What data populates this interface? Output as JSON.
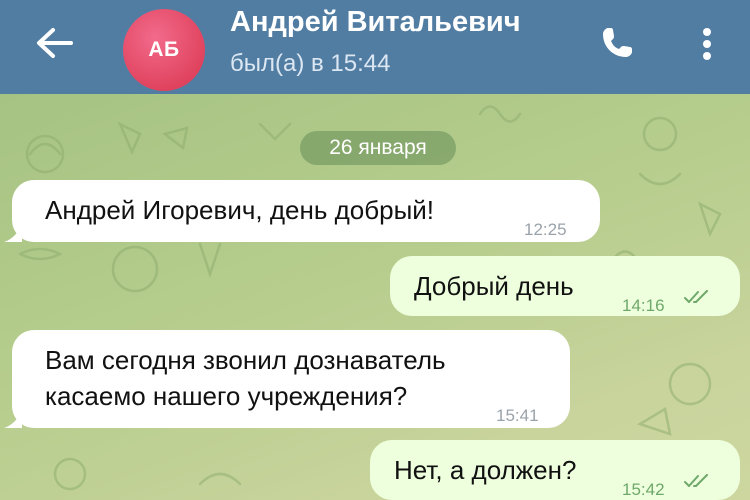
{
  "header": {
    "back_icon": "arrow-left-icon",
    "avatar_initials": "АБ",
    "contact_name": "Андрей Витальевич",
    "status": "был(а) в 15:44",
    "call_icon": "phone-icon",
    "menu_icon": "vertical-dots-icon",
    "color": "#527da3"
  },
  "chat": {
    "date": "26 января",
    "messages": [
      {
        "direction": "incoming",
        "text": "Андрей Игоревич, день добрый!",
        "time": "12:25"
      },
      {
        "direction": "outgoing",
        "text": "Добрый день",
        "time": "14:16",
        "status_icon": "double-check-icon"
      },
      {
        "direction": "incoming",
        "lines": [
          "Вам сегодня звонил дознаватель",
          "касаемо нашего учреждения?"
        ],
        "time": "15:41"
      },
      {
        "direction": "outgoing",
        "text": "Нет, а должен?",
        "time": "15:42",
        "status_icon": "double-check-icon"
      }
    ],
    "colors": {
      "incoming": "#ffffff",
      "outgoing": "#eeffdd",
      "time_outgoing": "#6ea86a"
    }
  }
}
